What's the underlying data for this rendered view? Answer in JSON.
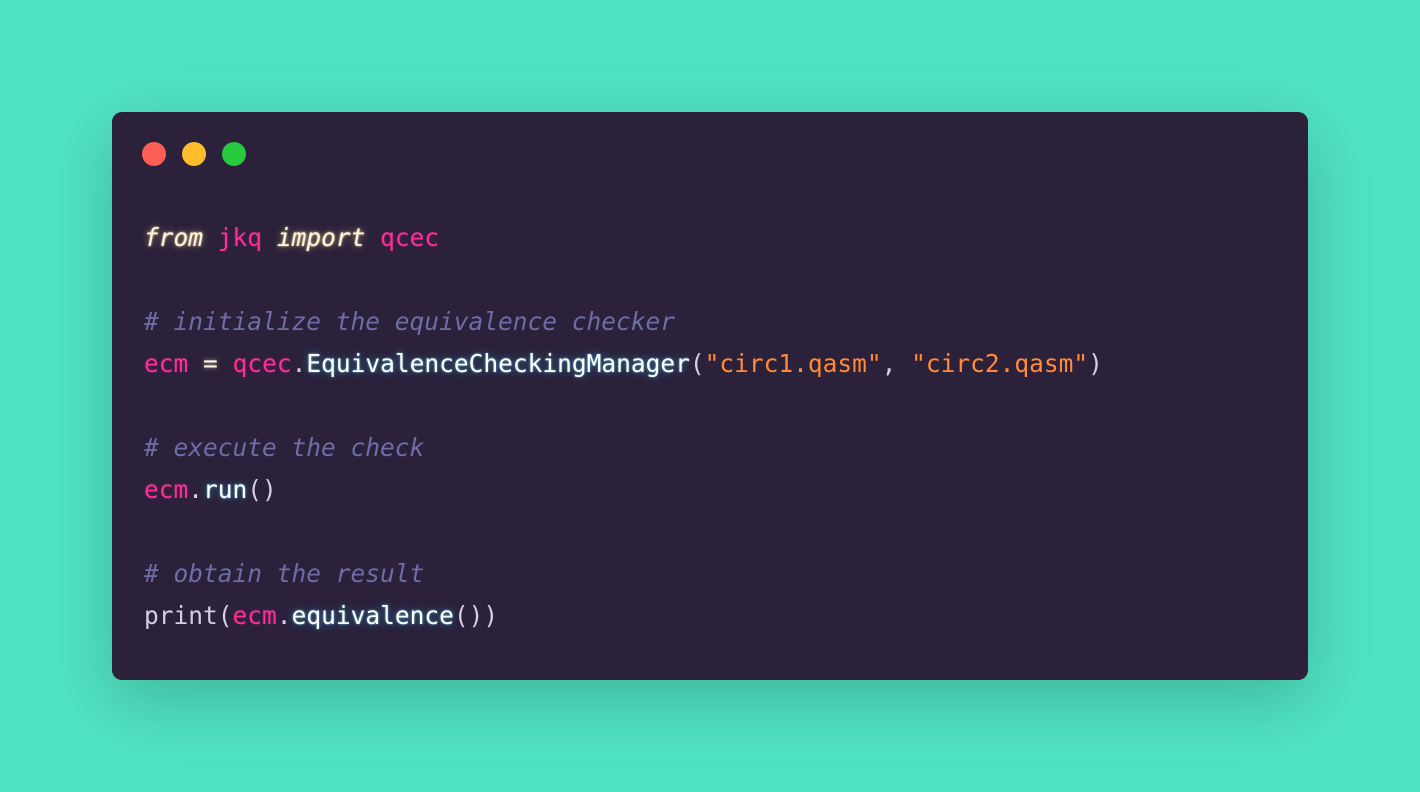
{
  "colors": {
    "background": "#50e3c2",
    "window": "#2b213a",
    "keyword": "#fdf6e3",
    "identifier": "#ff2e97",
    "function": "#ffffff",
    "string": "#ff8b39",
    "comment": "#6f6ca6",
    "punctuation": "#d7cde8",
    "builtin": "#d7cde8",
    "dot_close": "#ff5f56",
    "dot_minimize": "#ffbd2e",
    "dot_maximize": "#27c93f"
  },
  "window_controls": {
    "close_icon": "red-circle",
    "minimize_icon": "yellow-circle",
    "maximize_icon": "green-circle"
  },
  "code": {
    "lines": [
      [
        {
          "t": "from",
          "k": "keyword"
        },
        {
          "t": " ",
          "k": "space"
        },
        {
          "t": "jkq",
          "k": "identifier"
        },
        {
          "t": " ",
          "k": "space"
        },
        {
          "t": "import",
          "k": "keyword"
        },
        {
          "t": " ",
          "k": "space"
        },
        {
          "t": "qcec",
          "k": "identifier"
        }
      ],
      [],
      [
        {
          "t": "# initialize the equivalence checker",
          "k": "comment"
        }
      ],
      [
        {
          "t": "ecm",
          "k": "identifier"
        },
        {
          "t": " ",
          "k": "space"
        },
        {
          "t": "=",
          "k": "operator"
        },
        {
          "t": " ",
          "k": "space"
        },
        {
          "t": "qcec",
          "k": "identifier"
        },
        {
          "t": ".",
          "k": "punctuation"
        },
        {
          "t": "EquivalenceCheckingManager",
          "k": "function"
        },
        {
          "t": "(",
          "k": "punctuation"
        },
        {
          "t": "\"circ1.qasm\"",
          "k": "string"
        },
        {
          "t": ", ",
          "k": "punctuation"
        },
        {
          "t": "\"circ2.qasm\"",
          "k": "string"
        },
        {
          "t": ")",
          "k": "punctuation"
        }
      ],
      [],
      [
        {
          "t": "# execute the check",
          "k": "comment"
        }
      ],
      [
        {
          "t": "ecm",
          "k": "identifier"
        },
        {
          "t": ".",
          "k": "punctuation"
        },
        {
          "t": "run",
          "k": "function"
        },
        {
          "t": "()",
          "k": "punctuation"
        }
      ],
      [],
      [
        {
          "t": "# obtain the result",
          "k": "comment"
        }
      ],
      [
        {
          "t": "print",
          "k": "builtin"
        },
        {
          "t": "(",
          "k": "punctuation"
        },
        {
          "t": "ecm",
          "k": "identifier"
        },
        {
          "t": ".",
          "k": "punctuation"
        },
        {
          "t": "equivalence",
          "k": "function"
        },
        {
          "t": "())",
          "k": "punctuation"
        }
      ]
    ]
  }
}
